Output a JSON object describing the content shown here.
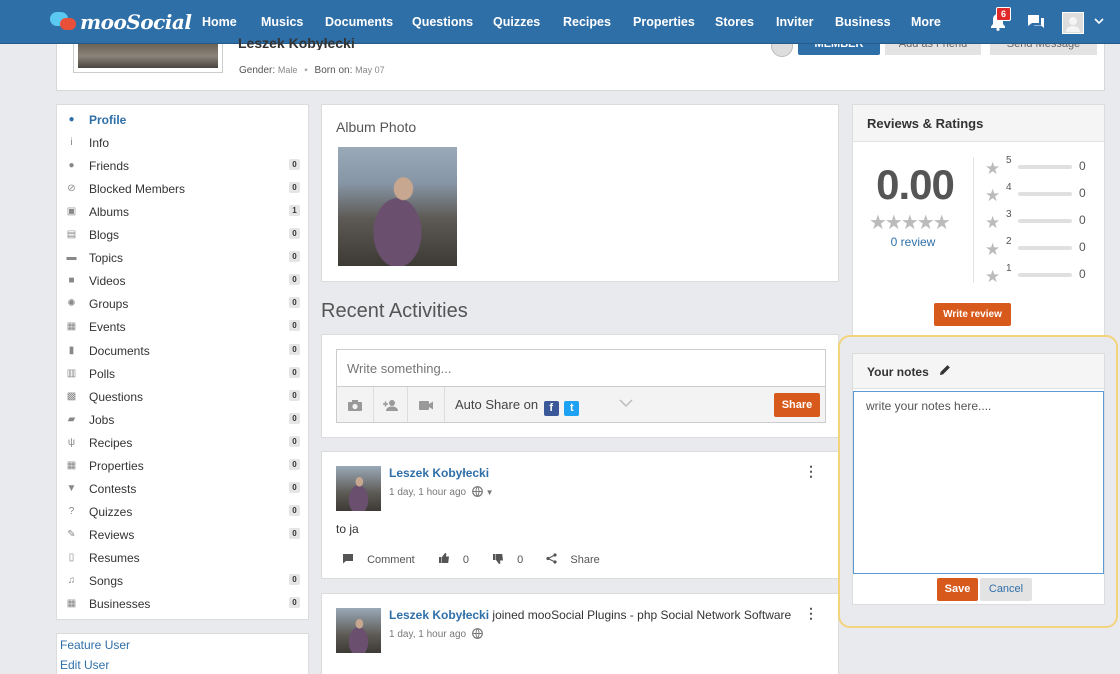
{
  "brand": {
    "name": "mooSocial"
  },
  "nav": {
    "items": [
      "Home",
      "Musics",
      "Documents",
      "Questions",
      "Quizzes",
      "Recipes",
      "Properties",
      "Stores",
      "Inviter",
      "Business",
      "More"
    ],
    "notifications_count": "6"
  },
  "profile": {
    "name": "Leszek Kobyłecki",
    "gender_label": "Gender:",
    "gender_value": "Male",
    "born_label": "Born on:",
    "born_value": "May 07",
    "member_label": "MEMBER",
    "add_friend_label": "Add as Friend",
    "send_message_label": "Send Message"
  },
  "menu": {
    "items": [
      {
        "label": "Profile",
        "icon": "person-icon",
        "count": null,
        "active": true
      },
      {
        "label": "Info",
        "icon": "info-icon",
        "count": null
      },
      {
        "label": "Friends",
        "icon": "people-icon",
        "count": "0"
      },
      {
        "label": "Blocked Members",
        "icon": "block-icon",
        "count": "0"
      },
      {
        "label": "Albums",
        "icon": "albums-icon",
        "count": "1"
      },
      {
        "label": "Blogs",
        "icon": "blog-icon",
        "count": "0"
      },
      {
        "label": "Topics",
        "icon": "topic-icon",
        "count": "0"
      },
      {
        "label": "Videos",
        "icon": "video-icon",
        "count": "0"
      },
      {
        "label": "Groups",
        "icon": "groups-icon",
        "count": "0"
      },
      {
        "label": "Events",
        "icon": "calendar-icon",
        "count": "0"
      },
      {
        "label": "Documents",
        "icon": "document-icon",
        "count": "0"
      },
      {
        "label": "Polls",
        "icon": "poll-icon",
        "count": "0"
      },
      {
        "label": "Questions",
        "icon": "question-icon",
        "count": "0"
      },
      {
        "label": "Jobs",
        "icon": "briefcase-icon",
        "count": "0"
      },
      {
        "label": "Recipes",
        "icon": "fork-knife-icon",
        "count": "0"
      },
      {
        "label": "Properties",
        "icon": "building-icon",
        "count": "0"
      },
      {
        "label": "Contests",
        "icon": "trophy-icon",
        "count": "0"
      },
      {
        "label": "Quizzes",
        "icon": "quiz-icon",
        "count": "0"
      },
      {
        "label": "Reviews",
        "icon": "review-icon",
        "count": "0"
      },
      {
        "label": "Resumes",
        "icon": "resume-icon",
        "count": null
      },
      {
        "label": "Songs",
        "icon": "music-icon",
        "count": "0"
      },
      {
        "label": "Businesses",
        "icon": "business-icon",
        "count": "0"
      }
    ]
  },
  "admin": {
    "feature_user": "Feature User",
    "edit_user": "Edit User"
  },
  "album": {
    "title": "Album Photo"
  },
  "activities": {
    "title": "Recent Activities",
    "composer_placeholder": "Write something...",
    "auto_share": "Auto Share on",
    "share_label": "Share",
    "posts": [
      {
        "author": "Leszek Kobyłecki",
        "suffix": "",
        "time": "1 day, 1 hour ago",
        "body": "to ja",
        "comment_label": "Comment",
        "likes": "0",
        "dislikes": "0",
        "share_label": "Share"
      },
      {
        "author": "Leszek Kobyłecki",
        "suffix": " joined mooSocial Plugins - php Social Network Software",
        "time": "1 day, 1 hour ago"
      }
    ]
  },
  "reviews": {
    "title": "Reviews & Ratings",
    "average": "0.00",
    "average_fraction": 0,
    "count_label": "0 review",
    "rows": [
      {
        "stars": "5",
        "count": "0",
        "fraction": 0
      },
      {
        "stars": "4",
        "count": "0",
        "fraction": 0
      },
      {
        "stars": "3",
        "count": "0",
        "fraction": 0
      },
      {
        "stars": "2",
        "count": "0",
        "fraction": 0
      },
      {
        "stars": "1",
        "count": "0",
        "fraction": 0
      }
    ],
    "write_label": "Write review"
  },
  "notes": {
    "title": "Your notes",
    "value": "write your notes here....",
    "save_label": "Save",
    "cancel_label": "Cancel"
  },
  "colors": {
    "brand_blue": "#2f6fa8",
    "accent_orange": "#d8591c",
    "highlight": "#f3d37c"
  }
}
